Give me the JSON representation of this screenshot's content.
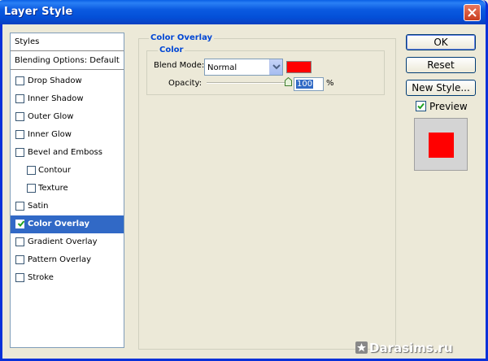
{
  "window": {
    "title": "Layer Style"
  },
  "styles_list": {
    "header": "Styles",
    "blending_options": "Blending Options: Default",
    "items": [
      {
        "label": "Drop Shadow",
        "checked": false,
        "selected": false
      },
      {
        "label": "Inner Shadow",
        "checked": false,
        "selected": false
      },
      {
        "label": "Outer Glow",
        "checked": false,
        "selected": false
      },
      {
        "label": "Inner Glow",
        "checked": false,
        "selected": false
      },
      {
        "label": "Bevel and Emboss",
        "checked": false,
        "selected": false
      },
      {
        "label": "Contour",
        "checked": false,
        "selected": false
      },
      {
        "label": "Texture",
        "checked": false,
        "selected": false
      },
      {
        "label": "Satin",
        "checked": false,
        "selected": false
      },
      {
        "label": "Color Overlay",
        "checked": true,
        "selected": true
      },
      {
        "label": "Gradient Overlay",
        "checked": false,
        "selected": false
      },
      {
        "label": "Pattern Overlay",
        "checked": false,
        "selected": false
      },
      {
        "label": "Stroke",
        "checked": false,
        "selected": false
      }
    ]
  },
  "panel": {
    "title": "Color Overlay",
    "group_title": "Color",
    "blend_mode_label": "Blend Mode:",
    "blend_mode_value": "Normal",
    "overlay_color": "#ff0000",
    "opacity_label": "Opacity:",
    "opacity_value": "100",
    "opacity_percent": 100,
    "opacity_unit": "%"
  },
  "buttons": {
    "ok": "OK",
    "reset": "Reset",
    "new_style": "New Style..."
  },
  "preview": {
    "label": "Preview",
    "checked": true,
    "color": "#ff0000"
  },
  "watermark": "Darasims.ru"
}
